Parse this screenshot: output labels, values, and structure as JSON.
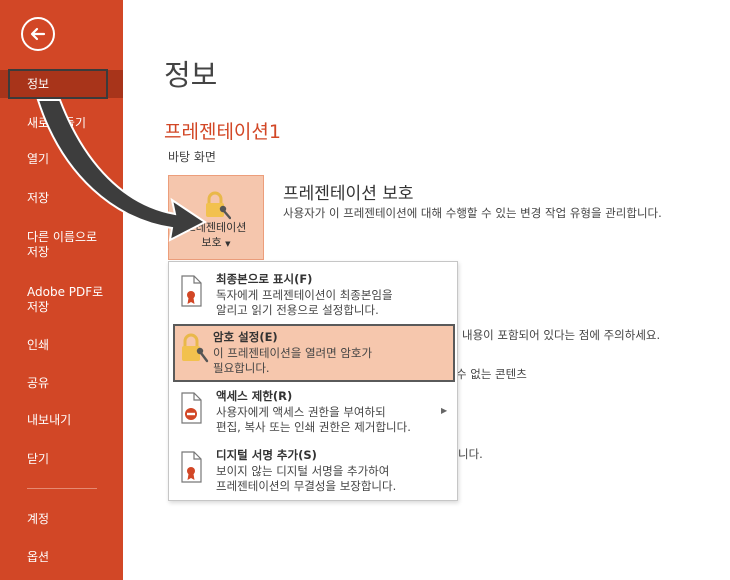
{
  "sidebar": {
    "items": [
      {
        "label": "정보",
        "active": true
      },
      {
        "label": "새로 만들기"
      },
      {
        "label": "열기"
      },
      {
        "label": "저장"
      },
      {
        "label": "다른 이름으로\n저장"
      },
      {
        "label": "Adobe PDF로\n저장"
      },
      {
        "label": "인쇄"
      },
      {
        "label": "공유"
      },
      {
        "label": "내보내기"
      },
      {
        "label": "닫기"
      },
      {
        "label": "계정"
      },
      {
        "label": "옵션"
      }
    ]
  },
  "main": {
    "page_title": "정보",
    "doc_title": "프레젠테이션1",
    "doc_location": "바탕 화면",
    "protect": {
      "button_label_line1": "프레젠테이션",
      "button_label_line2": "보호",
      "heading": "프레젠테이션 보호",
      "description": "사용자가 이 프레젠테이션에 대해 수행할 수 있는 변경 작업 유형을 관리합니다."
    },
    "background_text": {
      "line1": "내용이 포함되어 있다는 점에 주의하세요.",
      "line2": "수 없는 콘텐츠",
      "line3": "니다."
    }
  },
  "menu": {
    "items": [
      {
        "title": "최종본으로 표시(F)",
        "desc_line1": "독자에게 프레젠테이션이 최종본임을",
        "desc_line2": "알리고 읽기 전용으로 설정합니다."
      },
      {
        "title": "암호 설정(E)",
        "desc_line1": "이 프레젠테이션을 열려면 암호가",
        "desc_line2": "필요합니다."
      },
      {
        "title": "액세스 제한(R)",
        "desc_line1": "사용자에게 액세스 권한을 부여하되",
        "desc_line2": "편집, 복사 또는 인쇄 권한은 제거합니다."
      },
      {
        "title": "디지털 서명 추가(S)",
        "desc_line1": "보이지 않는 디지털 서명을 추가하여",
        "desc_line2": "프레젠테이션의 무결성을 보장합니다."
      }
    ],
    "submenu_arrow": "▶"
  },
  "colors": {
    "accent": "#d24726",
    "highlight": "#f6c7ad"
  }
}
